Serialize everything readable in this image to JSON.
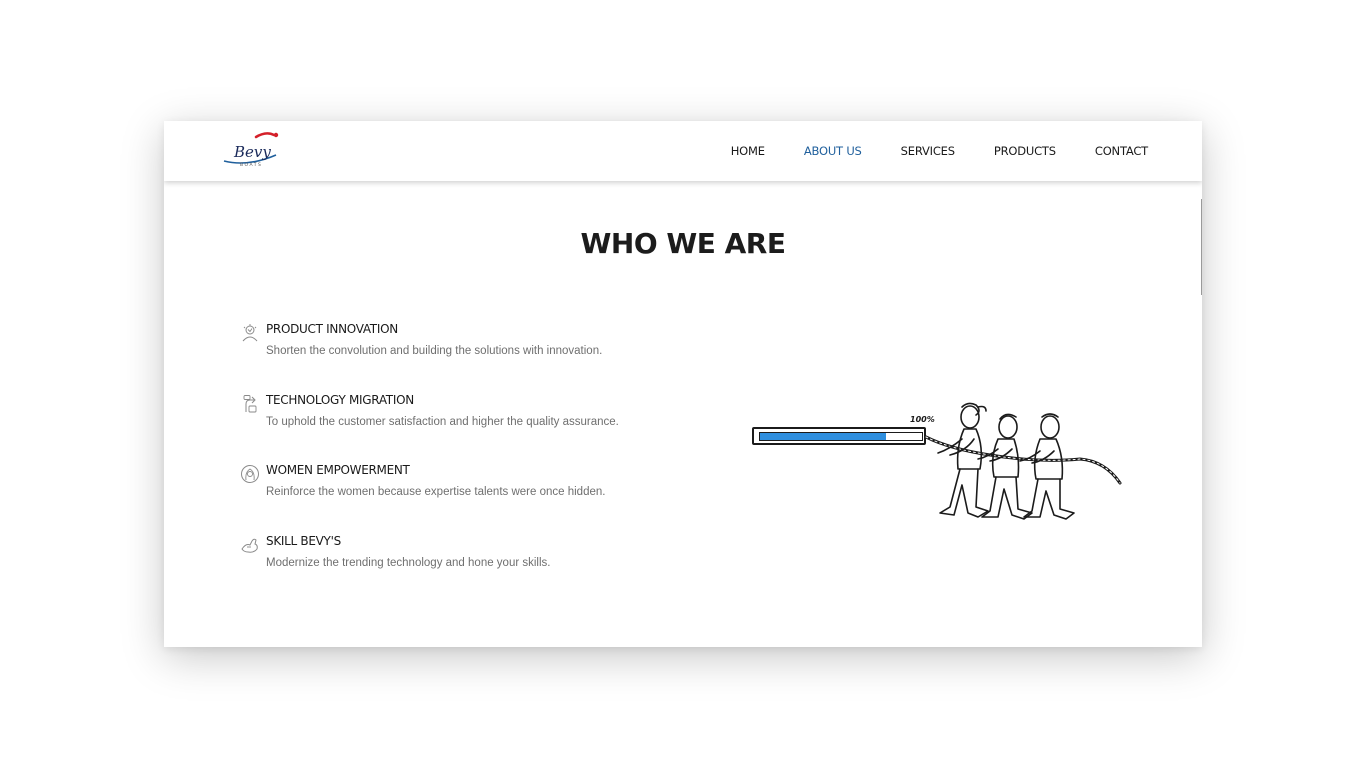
{
  "brand": {
    "logo_text": "Bevy",
    "logo_subtext": "BOATS",
    "accent_color": "#1f5f9c",
    "logo_red": "#d4202a"
  },
  "nav": {
    "items": [
      {
        "label": "HOME",
        "active": false
      },
      {
        "label": "ABOUT US",
        "active": true
      },
      {
        "label": "SERVICES",
        "active": false
      },
      {
        "label": "PRODUCTS",
        "active": false
      },
      {
        "label": "CONTACT",
        "active": false
      }
    ]
  },
  "section": {
    "title": "WHO WE ARE"
  },
  "features": [
    {
      "icon": "innovation-icon",
      "title": "PRODUCT INNOVATION",
      "description": "Shorten the convolution and building the solutions with innovation."
    },
    {
      "icon": "migration-icon",
      "title": "TECHNOLOGY MIGRATION",
      "description": "To uphold the customer satisfaction and higher the quality assurance."
    },
    {
      "icon": "women-icon",
      "title": "WOMEN EMPOWERMENT",
      "description": "Reinforce the women because expertise talents were once hidden."
    },
    {
      "icon": "skill-icon",
      "title": "SKILL BEVY'S",
      "description": "Modernize the trending technology and hone your skills."
    }
  ],
  "illustration": {
    "progress_label": "100%",
    "progress_fill": 0.78,
    "progress_color": "#2f8fdf"
  }
}
